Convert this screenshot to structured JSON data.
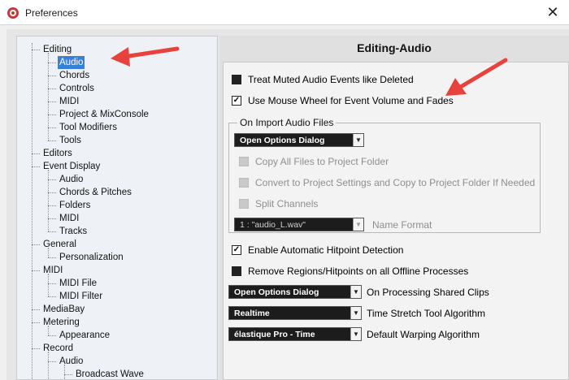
{
  "window": {
    "title": "Preferences",
    "close_glyph": "✕"
  },
  "tree": {
    "items": [
      {
        "label": "Editing",
        "level": 1
      },
      {
        "label": "Audio",
        "level": 2,
        "selected": true
      },
      {
        "label": "Chords",
        "level": 2
      },
      {
        "label": "Controls",
        "level": 2
      },
      {
        "label": "MIDI",
        "level": 2
      },
      {
        "label": "Project & MixConsole",
        "level": 2
      },
      {
        "label": "Tool Modifiers",
        "level": 2
      },
      {
        "label": "Tools",
        "level": 2
      },
      {
        "label": "Editors",
        "level": 1
      },
      {
        "label": "Event Display",
        "level": 1
      },
      {
        "label": "Audio",
        "level": 2
      },
      {
        "label": "Chords & Pitches",
        "level": 2
      },
      {
        "label": "Folders",
        "level": 2
      },
      {
        "label": "MIDI",
        "level": 2
      },
      {
        "label": "Tracks",
        "level": 2
      },
      {
        "label": "General",
        "level": 1
      },
      {
        "label": "Personalization",
        "level": 2
      },
      {
        "label": "MIDI",
        "level": 1
      },
      {
        "label": "MIDI File",
        "level": 2
      },
      {
        "label": "MIDI Filter",
        "level": 2
      },
      {
        "label": "MediaBay",
        "level": 1
      },
      {
        "label": "Metering",
        "level": 1
      },
      {
        "label": "Appearance",
        "level": 2
      },
      {
        "label": "Record",
        "level": 1
      },
      {
        "label": "Audio",
        "level": 2
      },
      {
        "label": "Broadcast Wave",
        "level": 3
      }
    ]
  },
  "panel": {
    "title": "Editing-Audio",
    "treat_muted": {
      "label": "Treat Muted Audio Events like Deleted",
      "checked": false
    },
    "mouse_wheel": {
      "label": "Use Mouse Wheel for Event Volume and Fades",
      "checked": true
    },
    "import_group": {
      "title": "On Import Audio Files",
      "dropdown_value": "Open Options Dialog",
      "copy_files": {
        "label": "Copy All Files to Project Folder",
        "disabled": true
      },
      "convert": {
        "label": "Convert to Project Settings and Copy to Project Folder If Needed",
        "disabled": true
      },
      "split": {
        "label": "Split Channels",
        "disabled": true
      },
      "name_format_value": "1 : \"audio_L.wav\"",
      "name_format_label": "Name Format"
    },
    "hitpoint": {
      "label": "Enable Automatic Hitpoint Detection",
      "checked": true
    },
    "remove_regions": {
      "label": "Remove Regions/Hitpoints on all Offline Processes",
      "checked": false
    },
    "shared_clips": {
      "value": "Open Options Dialog",
      "label": "On Processing Shared Clips"
    },
    "time_stretch": {
      "value": "Realtime",
      "label": "Time Stretch Tool Algorithm"
    },
    "warping": {
      "value": "élastique Pro - Time",
      "label": "Default Warping Algorithm"
    }
  },
  "colors": {
    "selection": "#3a7fd5",
    "annotation_arrow": "#e8423c",
    "dropdown_bg": "#1c1c1c"
  },
  "icons": {
    "check": "✓",
    "chevron": "▼"
  }
}
